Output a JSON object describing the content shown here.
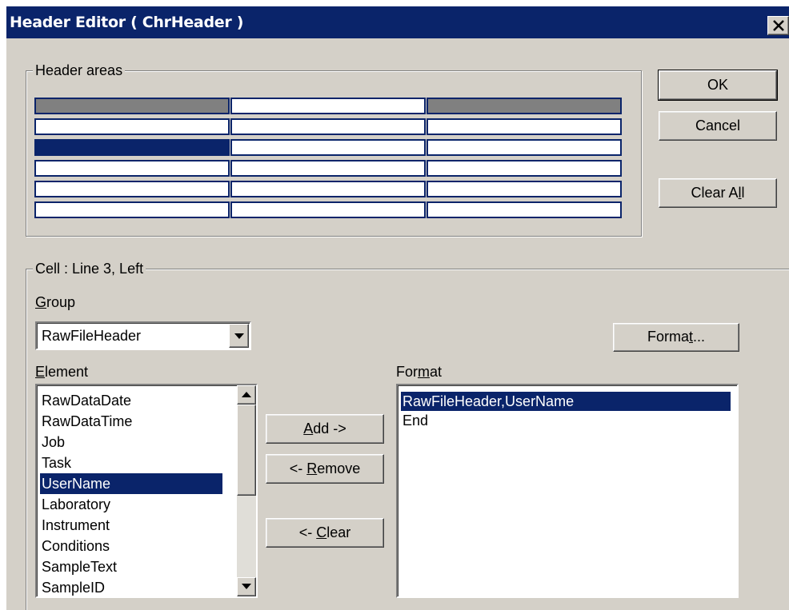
{
  "window": {
    "title": "Header Editor ( ChrHeader )",
    "close_label": "Close"
  },
  "header_areas": {
    "legend": "Header areas",
    "rows": [
      [
        "gray",
        "white",
        "gray"
      ],
      [
        "white",
        "white",
        "white"
      ],
      [
        "selected",
        "white",
        "white"
      ],
      [
        "white",
        "white",
        "white"
      ],
      [
        "white",
        "white",
        "white"
      ],
      [
        "white",
        "white",
        "white"
      ]
    ]
  },
  "buttons": {
    "ok": "OK",
    "cancel": "Cancel",
    "clear_all_pre": "Clear A",
    "clear_all_ul": "l",
    "clear_all_post": "l"
  },
  "cell": {
    "legend": "Cell : Line 3, Left",
    "group_label_ul": "G",
    "group_label_rest": "roup",
    "group_value": "RawFileHeader",
    "format_btn_pre": "Forma",
    "format_btn_ul": "t",
    "format_btn_post": "...",
    "element_label_ul": "E",
    "element_label_rest": "lement",
    "elements": [
      "RawDataDate",
      "RawDataTime",
      "Job",
      "Task",
      "UserName",
      "Laboratory",
      "Instrument",
      "Conditions",
      "SampleText",
      "SampleID"
    ],
    "selected_element": "UserName",
    "add_ul": "A",
    "add_rest": "dd ->",
    "remove_pre": "<- ",
    "remove_ul": "R",
    "remove_rest": "emove",
    "clear_pre": "<- ",
    "clear_ul": "C",
    "clear_rest": "lear",
    "format_label_pre": "For",
    "format_label_ul": "m",
    "format_label_post": "at",
    "format_items": [
      "RawFileHeader,UserName",
      "End"
    ],
    "selected_format": "RawFileHeader,UserName"
  },
  "colors": {
    "title_bar": "#0a246a",
    "face": "#d4d0c8",
    "selection": "#0a246a"
  }
}
